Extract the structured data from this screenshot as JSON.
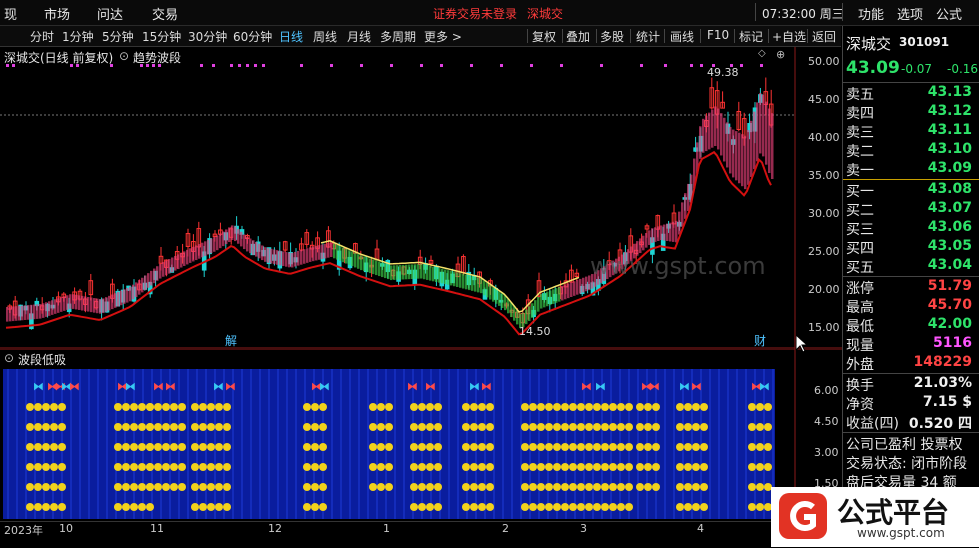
{
  "menubar": {
    "items": [
      "现",
      "市场",
      "问达",
      "交易"
    ],
    "notice": "证券交易未登录",
    "stock_tab": "深城交",
    "clock": "07:32:00 周三",
    "right": [
      "功能",
      "选项",
      "公式"
    ]
  },
  "periods": [
    "分时",
    "1分钟",
    "5分钟",
    "15分钟",
    "30分钟",
    "60分钟",
    "日线",
    "周线",
    "月线",
    "多周期",
    "更多 >"
  ],
  "active_period": "日线",
  "tools": [
    "复权",
    "叠加",
    "多股",
    "统计",
    "画线",
    "F10",
    "标记",
    "+自选",
    "返回"
  ],
  "main_chart": {
    "title": "深城交(日线 前复权)",
    "indicator": "趋势波段",
    "high_label": "49.38",
    "low_label": "14.50",
    "marker_jie": "解",
    "marker_cai": "财",
    "watermark": "www.gspt.com",
    "y_ticks": [
      "50.00",
      "45.00",
      "40.00",
      "35.00",
      "30.00",
      "25.00",
      "20.00",
      "15.00"
    ]
  },
  "sub_chart": {
    "title": "波段低吸",
    "y_ticks": [
      "6.00",
      "4.50",
      "3.00",
      "1.50"
    ]
  },
  "x_axis": {
    "year": "2023年",
    "months": [
      "10",
      "11",
      "12",
      "1",
      "2",
      "3",
      "4"
    ]
  },
  "chart_data": {
    "type": "candlestick",
    "title": "深城交(日线 前复权)",
    "ylim": [
      13,
      52
    ],
    "x_months": [
      "10",
      "11",
      "12",
      "1",
      "2",
      "3",
      "4"
    ],
    "high": 49.38,
    "low": 14.5,
    "last": 43.09,
    "colors": {
      "up": "#ff3333",
      "down": "#1ed4d4",
      "ma": "#e01010"
    }
  },
  "quote": {
    "name": "深城交",
    "code": "301091",
    "price": "43.09",
    "change": "-0.07",
    "pct": "-0.16",
    "asks": [
      {
        "label": "卖五",
        "price": "43.13"
      },
      {
        "label": "卖四",
        "price": "43.12"
      },
      {
        "label": "卖三",
        "price": "43.11"
      },
      {
        "label": "卖二",
        "price": "43.10"
      },
      {
        "label": "卖一",
        "price": "43.09"
      }
    ],
    "bids": [
      {
        "label": "买一",
        "price": "43.08"
      },
      {
        "label": "买二",
        "price": "43.07"
      },
      {
        "label": "买三",
        "price": "43.06"
      },
      {
        "label": "买四",
        "price": "43.05"
      },
      {
        "label": "买五",
        "price": "43.04"
      }
    ],
    "stats": [
      {
        "label": "涨停",
        "value": "51.79",
        "color": "red"
      },
      {
        "label": "最高",
        "value": "45.70",
        "color": "red"
      },
      {
        "label": "最低",
        "value": "42.00",
        "color": "green"
      },
      {
        "label": "现量",
        "value": "5116",
        "color": "magenta"
      },
      {
        "label": "外盘",
        "value": "148229",
        "color": "red"
      }
    ],
    "stats2": [
      {
        "label": "换手",
        "value": "21.03%"
      },
      {
        "label": "净资",
        "value": "7.15 $"
      },
      {
        "label": "收益(四)",
        "value": "0.520 四"
      }
    ],
    "info": [
      "公司已盈利 投票权",
      "交易状态: 闭市阶段",
      "盘后交易量 34 额"
    ]
  },
  "logo": {
    "brand": "公式平台",
    "url": "www.gspt.com"
  }
}
